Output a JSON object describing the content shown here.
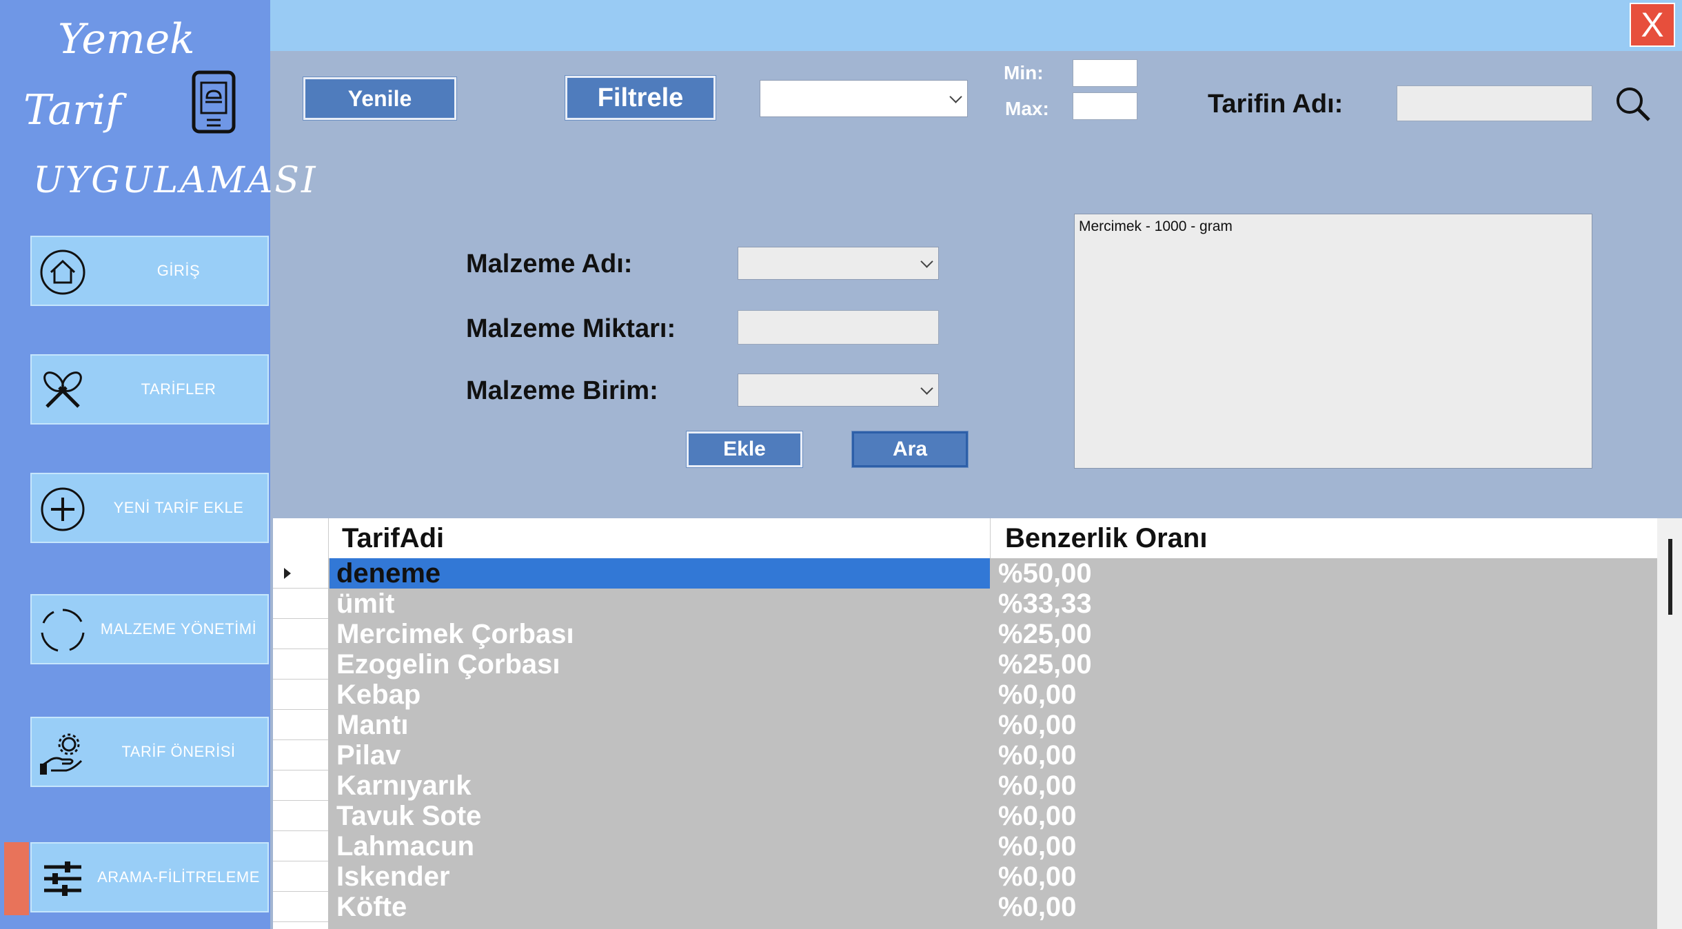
{
  "sidebar": {
    "logo": {
      "line1": "Yemek",
      "line2": "Tarif",
      "line3": "UYGULAMASI"
    },
    "items": [
      {
        "label": "GİRİŞ",
        "icon": "home-icon"
      },
      {
        "label": "TARİFLER",
        "icon": "whisk-icon"
      },
      {
        "label": "YENİ TARİF EKLE",
        "icon": "plus-circle-icon"
      },
      {
        "label": "MALZEME YÖNETİMİ",
        "icon": "loading-circle-icon"
      },
      {
        "label": "TARİF ÖNERİSİ",
        "icon": "hand-gear-icon"
      },
      {
        "label": "ARAMA-FİLİTRELEME",
        "icon": "sliders-icon",
        "active": true
      }
    ]
  },
  "topbar": {
    "close_label": "X"
  },
  "toolbar": {
    "refresh_label": "Yenile",
    "filter_label": "Filtrele",
    "filter_select_value": "",
    "min_label": "Min:",
    "max_label": "Max:",
    "min_value": "",
    "max_value": "",
    "recipe_name_label": "Tarifin Adı:",
    "recipe_name_value": ""
  },
  "ingredient_form": {
    "name_label": "Malzeme Adı:",
    "amount_label": "Malzeme Miktarı:",
    "unit_label": "Malzeme Birim:",
    "name_value": "",
    "amount_value": "",
    "unit_value": "",
    "add_label": "Ekle",
    "search_label": "Ara",
    "selected_items": [
      "Mercimek - 1000 - gram"
    ]
  },
  "grid": {
    "columns": [
      "TarifAdi",
      "Benzerlik Oranı"
    ],
    "rows": [
      [
        "deneme",
        "%50,00"
      ],
      [
        "ümit",
        "%33,33"
      ],
      [
        "Mercimek Çorbası",
        "%25,00"
      ],
      [
        "Ezogelin Çorbası",
        "%25,00"
      ],
      [
        "Kebap",
        "%0,00"
      ],
      [
        "Mantı",
        "%0,00"
      ],
      [
        "Pilav",
        "%0,00"
      ],
      [
        "Karnıyarık",
        "%0,00"
      ],
      [
        "Tavuk Sote",
        "%0,00"
      ],
      [
        "Lahmacun",
        "%0,00"
      ],
      [
        "Iskender",
        "%0,00"
      ],
      [
        "Köfte",
        "%0,00"
      ]
    ],
    "selected_row": 0
  },
  "colors": {
    "sidebar": "#6f97e6",
    "nav_item": "#99cef7",
    "content": "#a2b5d2",
    "button": "#4f7cbd",
    "close": "#e74f3c",
    "active_indicator": "#e8735a",
    "selection": "#3278d6"
  }
}
